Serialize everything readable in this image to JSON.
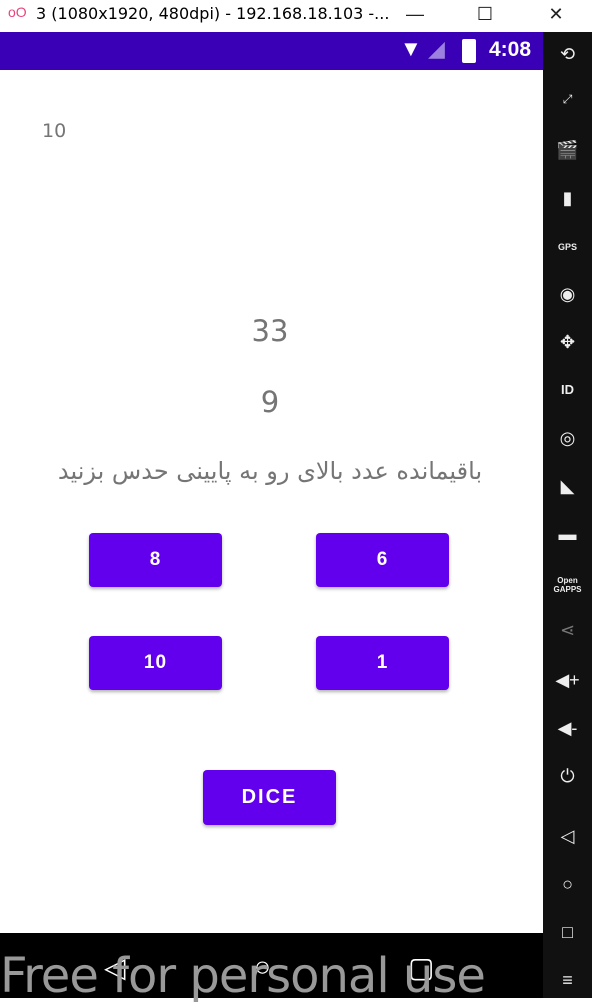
{
  "window": {
    "title": "3 (1080x1920, 480dpi) - 192.168.18.103 -...",
    "minimize": "—",
    "maximize": "☐",
    "close": "✕"
  },
  "status_bar": {
    "time": "4:08"
  },
  "app": {
    "corner_value": "10",
    "top_number": "33",
    "bottom_number": "9",
    "prompt": "باقیمانده عدد بالای رو به پایینی حدس بزنید",
    "options": [
      "8",
      "6",
      "10",
      "1"
    ],
    "dice_label": "DICE"
  },
  "colors": {
    "button": "#6200ee",
    "status_bar": "#3a00b5"
  },
  "sidebar_icons": [
    "rotate-icon",
    "one-to-one-icon",
    "clapperboard-icon",
    "battery-icon",
    "gps-icon",
    "camera-icon",
    "move-icon",
    "id-icon",
    "disc-icon",
    "cast-icon",
    "message-icon",
    "opengapps-icon",
    "share-icon",
    "volume-up-icon",
    "volume-down-icon",
    "power-icon",
    "back-icon",
    "home-icon",
    "recents-icon",
    "menu-icon"
  ],
  "sidebar_labels": {
    "gps": "GPS",
    "id": "ID",
    "opengapps": "Open GAPPS"
  },
  "watermark": "Free for personal use"
}
